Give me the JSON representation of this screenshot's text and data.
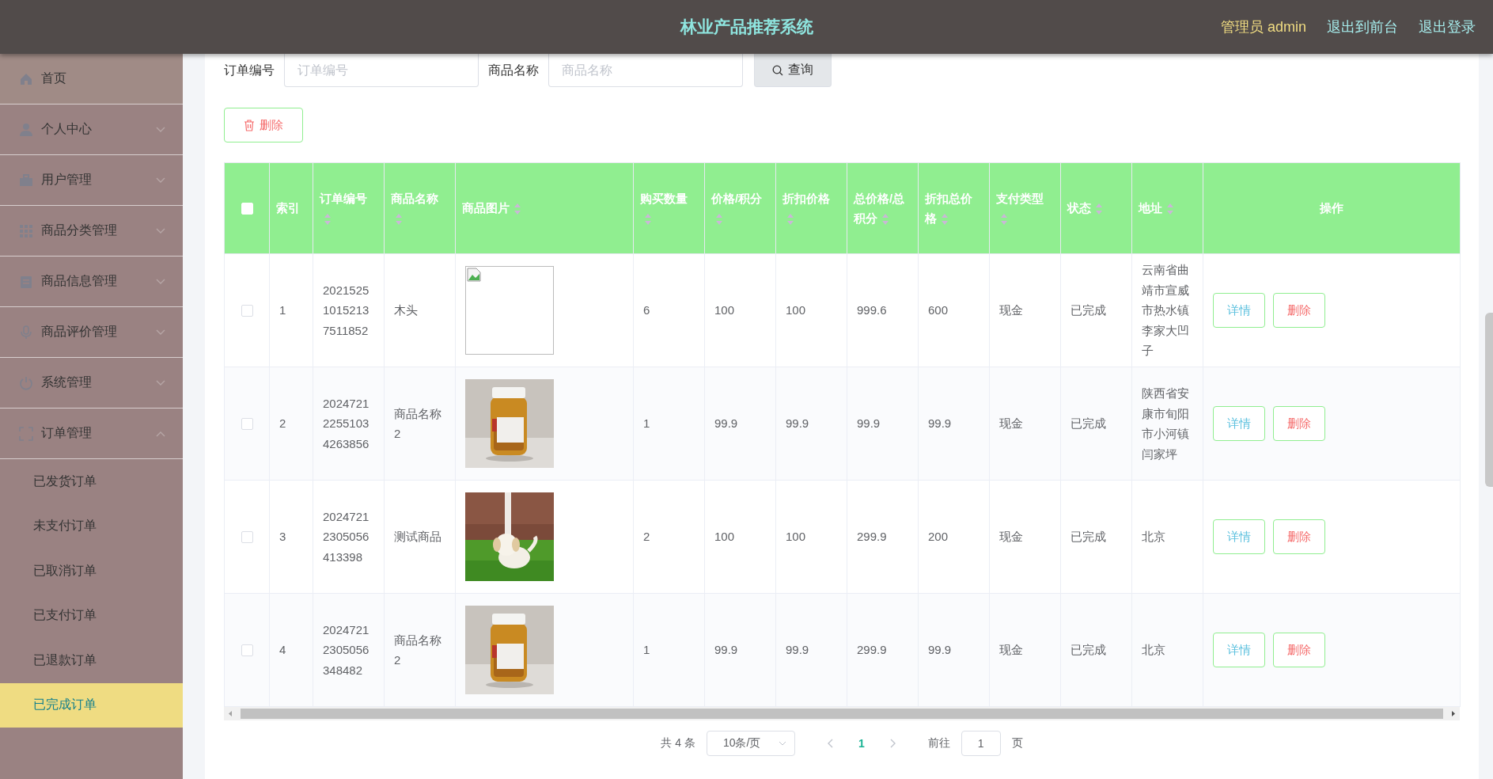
{
  "header": {
    "title": "林业产品推荐系统",
    "user": "管理员 admin",
    "links": [
      "退出到前台",
      "退出登录"
    ]
  },
  "sidebar": {
    "items": [
      {
        "kind": "link",
        "label": "首页"
      },
      {
        "kind": "menu",
        "label": "个人中心",
        "expanded": false
      },
      {
        "kind": "menu",
        "label": "用户管理",
        "expanded": false
      },
      {
        "kind": "menu",
        "label": "商品分类管理",
        "expanded": false
      },
      {
        "kind": "menu",
        "label": "商品信息管理",
        "expanded": false
      },
      {
        "kind": "menu",
        "label": "商品评价管理",
        "expanded": false
      },
      {
        "kind": "menu",
        "label": "系统管理",
        "expanded": false
      },
      {
        "kind": "menu",
        "label": "订单管理",
        "expanded": true,
        "children": [
          {
            "label": "已发货订单",
            "selected": false
          },
          {
            "label": "未支付订单",
            "selected": false
          },
          {
            "label": "已取消订单",
            "selected": false
          },
          {
            "label": "已支付订单",
            "selected": false
          },
          {
            "label": "已退款订单",
            "selected": false
          },
          {
            "label": "已完成订单",
            "selected": true
          }
        ]
      }
    ]
  },
  "search": {
    "fields": [
      {
        "label": "订单编号",
        "placeholder": "订单编号"
      },
      {
        "label": "商品名称",
        "placeholder": "商品名称"
      }
    ],
    "button": "查询"
  },
  "delete_button": "删除",
  "table": {
    "columns": [
      {
        "kind": "checkbox",
        "checked": false
      },
      {
        "kind": "text",
        "label": "索引",
        "sortable": false
      },
      {
        "kind": "text",
        "label": "订单编号",
        "sortable": true
      },
      {
        "kind": "text",
        "label": "商品名称",
        "sortable": true
      },
      {
        "kind": "text",
        "label": "商品图片",
        "sortable": true
      },
      {
        "kind": "text",
        "label": "购买数量",
        "sortable": true
      },
      {
        "kind": "text",
        "label": "价格/积分",
        "sortable": true
      },
      {
        "kind": "text",
        "label": "折扣价格",
        "sortable": true
      },
      {
        "kind": "text",
        "label": "总价格/总积分",
        "sortable": true
      },
      {
        "kind": "text",
        "label": "折扣总价格",
        "sortable": true
      },
      {
        "kind": "text",
        "label": "支付类型",
        "sortable": true
      },
      {
        "kind": "text",
        "label": "状态",
        "sortable": true
      },
      {
        "kind": "text",
        "label": "地址",
        "sortable": true
      },
      {
        "kind": "text",
        "label": "操作",
        "sortable": false
      }
    ],
    "rows": [
      {
        "checked": false,
        "index": "1",
        "order_no": "202152510152137511852",
        "product": "木头",
        "image": {
          "kind": "broken"
        },
        "quantity": "6",
        "price": "100",
        "discount_price": "100",
        "total": "999.6",
        "discount_total": "600",
        "payment": "现金",
        "status": "已完成",
        "address": "云南省曲靖市宣威市热水镇李家大凹子",
        "actions": [
          "详情",
          "删除"
        ]
      },
      {
        "checked": false,
        "index": "2",
        "order_no": "202472122551034263856",
        "product": "商品名称2",
        "quantity": "1",
        "price": "99.9",
        "discount_price": "99.9",
        "total": "99.9",
        "discount_total": "99.9",
        "payment": "现金",
        "status": "已完成",
        "address": "陕西省安康市旬阳市小河镇闫家坪",
        "actions": [
          "详情",
          "删除"
        ]
      },
      {
        "checked": false,
        "index": "3",
        "order_no": "20247212305056413398",
        "product": "测试商品",
        "quantity": "2",
        "price": "100",
        "discount_price": "100",
        "total": "299.9",
        "discount_total": "200",
        "payment": "现金",
        "status": "已完成",
        "address": "北京",
        "actions": [
          "详情",
          "删除"
        ]
      },
      {
        "checked": false,
        "index": "4",
        "order_no": "20247212305056348482",
        "product": "商品名称2",
        "quantity": "1",
        "price": "99.9",
        "discount_price": "99.9",
        "total": "299.9",
        "discount_total": "99.9",
        "payment": "现金",
        "status": "已完成",
        "address": "北京",
        "actions": [
          "详情",
          "删除"
        ]
      }
    ]
  },
  "pagination": {
    "total": "共 4 条",
    "page_size": "10条/页",
    "pages": [
      {
        "label": "1",
        "selected": true
      }
    ],
    "goto_label": "前往",
    "goto_value": "1",
    "page_suffix": "页"
  }
}
